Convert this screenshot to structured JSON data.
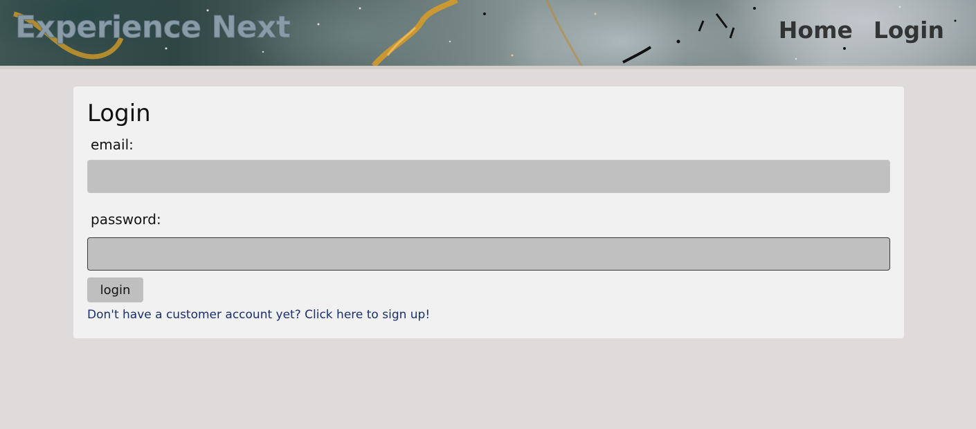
{
  "header": {
    "site_title": "Experience Next",
    "nav": [
      {
        "label": "Home"
      },
      {
        "label": "Login"
      }
    ]
  },
  "login_card": {
    "title": "Login",
    "email_label": "email:",
    "email_value": "",
    "password_label": "password:",
    "password_value": "",
    "submit_label": "login",
    "signup_link": "Don't have a customer account yet? Click here to sign up!"
  },
  "colors": {
    "page_background": "#dedbda",
    "card_background": "#f1f1f1",
    "input_background": "#c0c0c0",
    "link": "#1a2f6b"
  }
}
